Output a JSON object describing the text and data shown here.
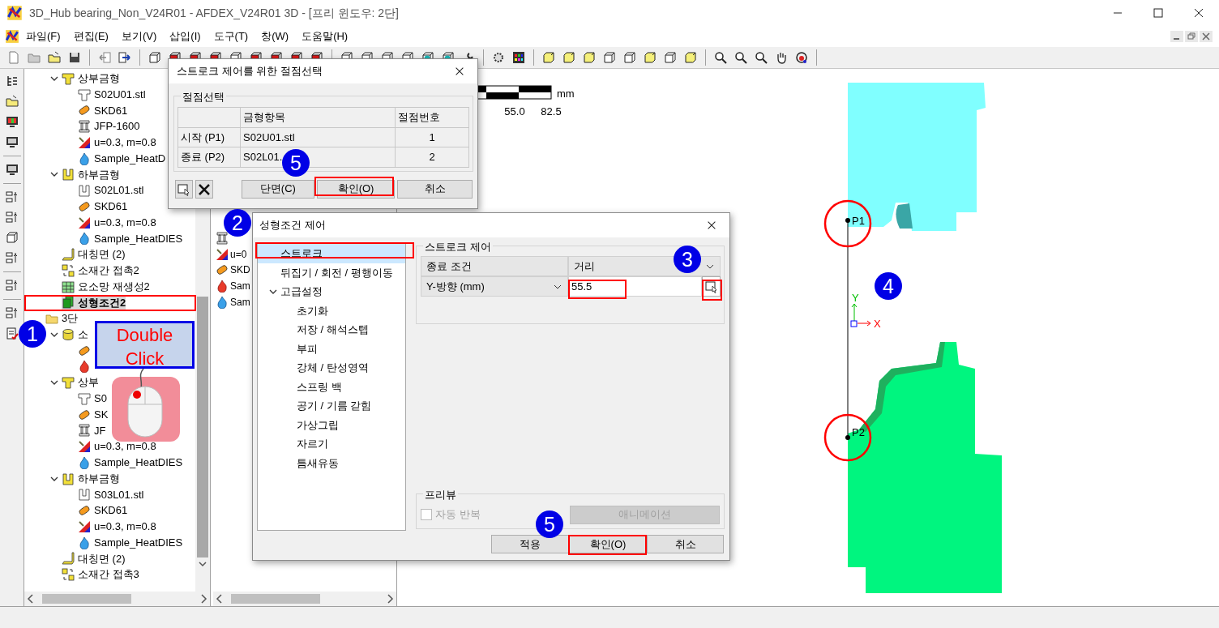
{
  "window": {
    "title": "3D_Hub bearing_Non_V24R01 - AFDEX_V24R01 3D - [프리 윈도우: 2단]"
  },
  "menu": [
    "파일(F)",
    "편집(E)",
    "보기(V)",
    "삽입(I)",
    "도구(T)",
    "창(W)",
    "도움말(H)"
  ],
  "tree": [
    {
      "label": "상부금형",
      "kind": "upper-die",
      "selected": false,
      "expanded": true,
      "children": [
        {
          "label": "S02U01.stl",
          "kind": "upper-stl",
          "selected": false
        },
        {
          "label": "SKD61",
          "kind": "material",
          "selected": false
        },
        {
          "label": "JFP-1600",
          "kind": "press",
          "selected": false
        },
        {
          "label": "u=0.3, m=0.8",
          "kind": "friction",
          "selected": false
        },
        {
          "label": "Sample_HeatD",
          "kind": "heat",
          "selected": false
        }
      ]
    },
    {
      "label": "하부금형",
      "kind": "lower-die",
      "selected": false,
      "expanded": true,
      "children": [
        {
          "label": "S02L01.stl",
          "kind": "lower-stl",
          "selected": false
        },
        {
          "label": "SKD61",
          "kind": "material",
          "selected": false
        },
        {
          "label": "u=0.3, m=0.8",
          "kind": "friction",
          "selected": false
        },
        {
          "label": "Sample_HeatDIES",
          "kind": "heat",
          "selected": false
        }
      ]
    },
    {
      "label": "대칭면 (2)",
      "kind": "symmetry",
      "selected": false
    },
    {
      "label": "소재간 접촉2",
      "kind": "contact",
      "selected": false
    },
    {
      "label": "요소망 재생성2",
      "kind": "remesh",
      "selected": false
    },
    {
      "label": "성형조건2",
      "kind": "condition",
      "selected": true
    },
    {
      "label": "3단",
      "kind": "folder",
      "selected": false,
      "children": [
        {
          "label": "소",
          "kind": "billet",
          "selected": false,
          "expanded": true,
          "children": [
            {
              "kind": "material",
              "selected": false
            },
            {
              "kind": "heat-red",
              "selected": false
            }
          ]
        },
        {
          "label": "상부",
          "kind": "upper-die",
          "selected": false,
          "expanded": true,
          "children": [
            {
              "label": "S0",
              "kind": "upper-stl",
              "selected": false
            },
            {
              "label": "SK",
              "kind": "material",
              "selected": false
            },
            {
              "label": "JF",
              "kind": "press",
              "selected": false
            },
            {
              "label": "u=0.3, m=0.8",
              "kind": "friction",
              "selected": false
            },
            {
              "label": "Sample_HeatDIES",
              "kind": "heat",
              "selected": false
            }
          ]
        },
        {
          "label": "하부금형",
          "kind": "lower-die",
          "selected": false,
          "expanded": true,
          "children": [
            {
              "label": "S03L01.stl",
              "kind": "lower-stl",
              "selected": false
            },
            {
              "label": "SKD61",
              "kind": "material",
              "selected": false
            },
            {
              "label": "u=0.3, m=0.8",
              "kind": "friction",
              "selected": false
            },
            {
              "label": "Sample_HeatDIES",
              "kind": "heat",
              "selected": false
            }
          ]
        },
        {
          "label": "대칭면 (2)",
          "kind": "symmetry",
          "selected": false
        },
        {
          "label": "소재간 접촉3",
          "kind": "contact",
          "selected": false
        }
      ]
    }
  ],
  "panel_items": [
    {
      "kind": "press"
    },
    {
      "kind": "friction",
      "label": "u=0"
    },
    {
      "kind": "material",
      "label": "SKD"
    },
    {
      "kind": "heat-red",
      "label": "Sam"
    },
    {
      "kind": "heat",
      "label": "Sam"
    }
  ],
  "node_dialog": {
    "title": "스트로크 제어를 위한 절점선택",
    "group": "절점선택",
    "columns": [
      "금형항목",
      "절점번호"
    ],
    "rows": [
      {
        "label": "시작 (P1)",
        "item": "S02U01.stl",
        "node": "1"
      },
      {
        "label": "종료 (P2)",
        "item": "S02L01.",
        "node": "2"
      }
    ],
    "buttons": [
      "단면(C)",
      "확인(O)",
      "취소"
    ]
  },
  "condition_dialog": {
    "title": "성형조건 제어",
    "nav": [
      {
        "label": "스트로크",
        "selected": true
      },
      {
        "label": "뒤집기 / 회전 / 평행이동",
        "selected": false
      },
      {
        "label": "고급설정",
        "selected": false,
        "expanded": true,
        "children": [
          {
            "label": "초기화",
            "selected": false
          },
          {
            "label": "저장 / 해석스텝",
            "selected": false
          },
          {
            "label": "부피",
            "selected": false
          },
          {
            "label": "강체 / 탄성영역",
            "selected": false
          },
          {
            "label": "스프링 백",
            "selected": false
          },
          {
            "label": "공기 / 기름 갇힘",
            "selected": false
          },
          {
            "label": "가상그립",
            "selected": false
          },
          {
            "label": "자르기",
            "selected": false
          },
          {
            "label": "틈새유동",
            "selected": false
          }
        ]
      }
    ],
    "group": "스트로크 제어",
    "end_condition": {
      "label": "종료 조건",
      "value": "거리"
    },
    "direction": {
      "value": "Y-방향 (mm)"
    },
    "distance": {
      "value": "55.5"
    },
    "preview": {
      "group": "프리뷰",
      "auto_repeat": {
        "label": "자동 반복",
        "checked": false,
        "disabled": true
      },
      "animation": {
        "label": "애니메이션",
        "disabled": true
      }
    },
    "buttons": [
      "적용",
      "확인(O)",
      "취소"
    ]
  },
  "viewport": {
    "scale": {
      "unit": "mm",
      "labels": [
        "55.0",
        "82.5"
      ]
    },
    "points": [
      "P1",
      "P2"
    ],
    "axes": [
      "Y",
      "X"
    ]
  },
  "annotations": {
    "badges": [
      "1",
      "2",
      "3",
      "4",
      "5",
      "5"
    ],
    "callout": "Double Click"
  }
}
